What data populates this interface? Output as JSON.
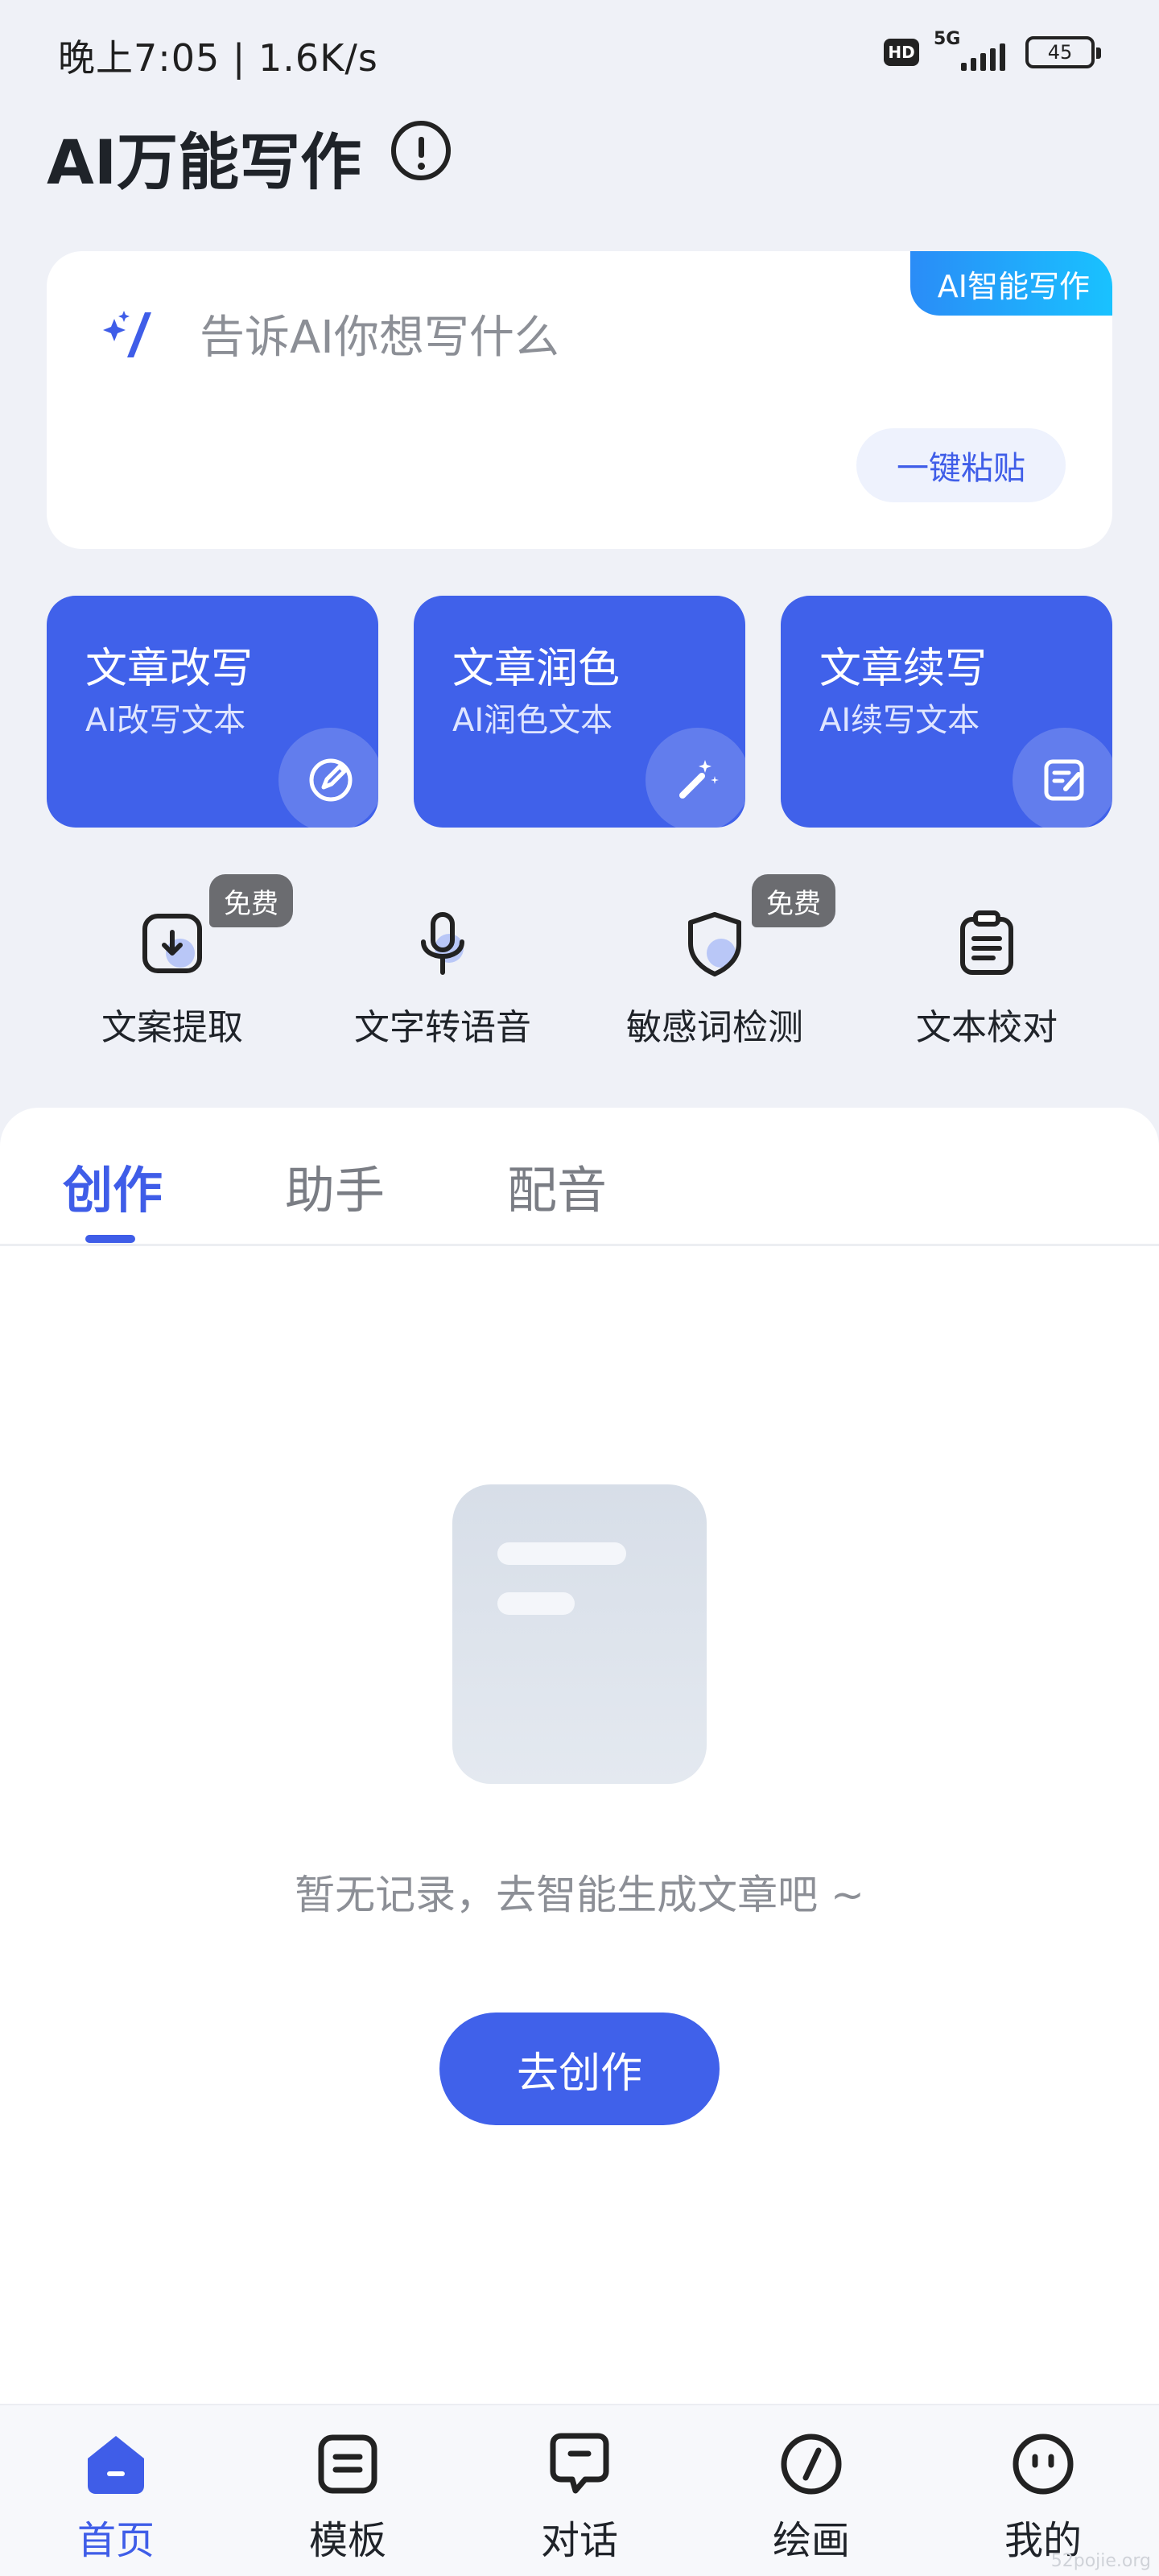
{
  "status_bar": {
    "time": "晚上7:05 | 1.6K/s",
    "hd": "HD",
    "network": "5G",
    "battery": "45"
  },
  "header": {
    "title": "AI万能写作",
    "info_icon": "info-circle-icon"
  },
  "prompt_card": {
    "tag": "AI智能写作",
    "placeholder": "告诉AI你想写什么",
    "paste_label": "一键粘贴"
  },
  "features": [
    {
      "title": "文章改写",
      "subtitle": "AI改写文本",
      "icon": "pen-edit-icon"
    },
    {
      "title": "文章润色",
      "subtitle": "AI润色文本",
      "icon": "magic-wand-icon"
    },
    {
      "title": "文章续写",
      "subtitle": "AI续写文本",
      "icon": "note-edit-icon"
    }
  ],
  "tools": [
    {
      "label": "文案提取",
      "badge": "免费",
      "icon": "download-box-icon"
    },
    {
      "label": "文字转语音",
      "badge": "",
      "icon": "microphone-icon"
    },
    {
      "label": "敏感词检测",
      "badge": "免费",
      "icon": "shield-icon"
    },
    {
      "label": "文本校对",
      "badge": "",
      "icon": "clipboard-icon"
    }
  ],
  "tabs": [
    {
      "label": "创作",
      "active": true
    },
    {
      "label": "助手",
      "active": false
    },
    {
      "label": "配音",
      "active": false
    }
  ],
  "empty_state": {
    "text": "暂无记录，去智能生成文章吧 ~",
    "button": "去创作"
  },
  "bottom_nav": [
    {
      "label": "首页",
      "icon": "home-icon",
      "active": true
    },
    {
      "label": "模板",
      "icon": "template-icon",
      "active": false
    },
    {
      "label": "对话",
      "icon": "chat-icon",
      "active": false
    },
    {
      "label": "绘画",
      "icon": "paint-icon",
      "active": false
    },
    {
      "label": "我的",
      "icon": "profile-icon",
      "active": false
    }
  ],
  "watermark": "52pojie.org",
  "colors": {
    "primary": "#4061ea",
    "background": "#eff1f7",
    "tag_gradient_start": "#2a8cf7",
    "tag_gradient_end": "#19c2ff"
  }
}
